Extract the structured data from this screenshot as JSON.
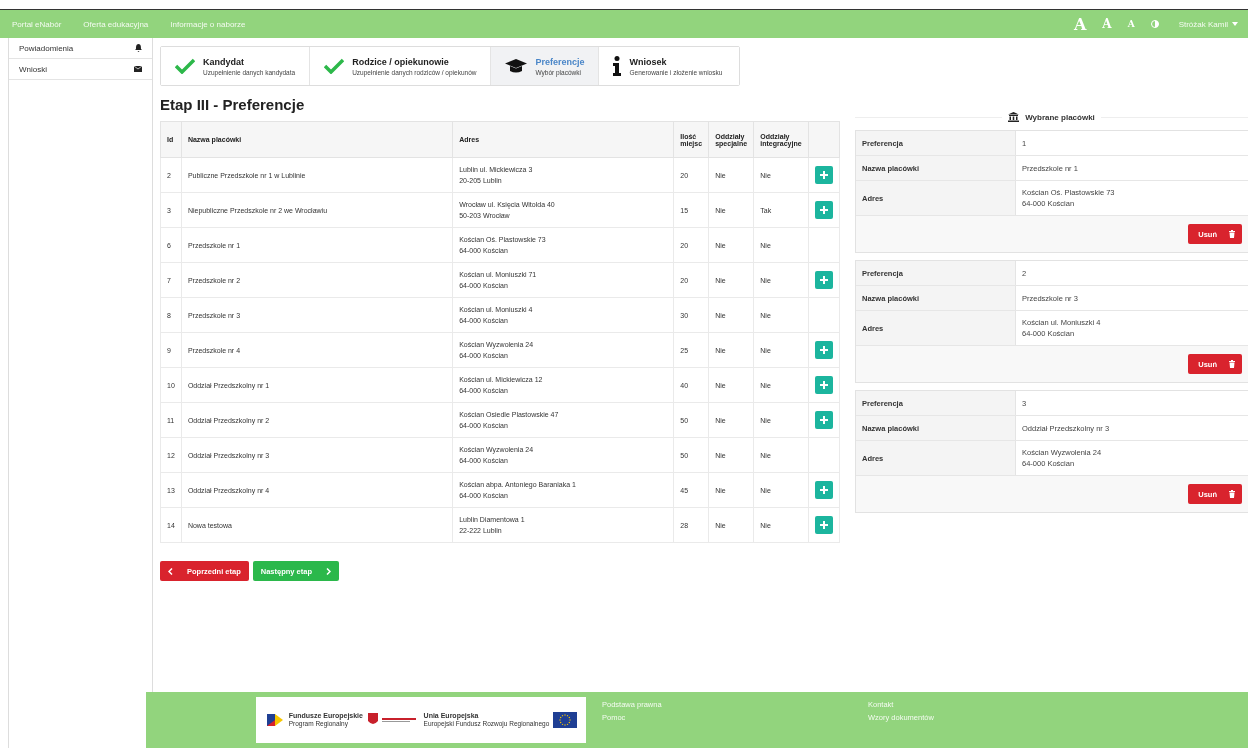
{
  "nav": {
    "links": [
      "Portal eNabór",
      "Oferta edukacyjna",
      "Informacje o naborze"
    ],
    "font_sizes": [
      "A",
      "A",
      "A"
    ],
    "user": "Stróżak Kamil"
  },
  "sidebar": {
    "items": [
      {
        "label": "Powiadomienia"
      },
      {
        "label": "Wnioski"
      }
    ]
  },
  "steps": [
    {
      "title": "Kandydat",
      "subtitle": "Uzupełnienie danych kandydata",
      "done": true,
      "selected": false
    },
    {
      "title": "Rodzice / opiekunowie",
      "subtitle": "Uzupełnienie danych rodziców / opiekunów",
      "done": true,
      "selected": false
    },
    {
      "title": "Preferencje",
      "subtitle": "Wybór placówki",
      "done": false,
      "selected": true
    },
    {
      "title": "Wniosek",
      "subtitle": "Generowanie i złożenie wniosku",
      "done": false,
      "selected": false
    }
  ],
  "heading": "Etap III - Preferencje",
  "table": {
    "columns": [
      "Id",
      "Nazwa placówki",
      "Adres",
      "Ilość miejsc",
      "Oddziały specjalne",
      "Oddziały integracyjne"
    ],
    "rows": [
      {
        "id": "2",
        "name": "Publiczne Przedszkole nr 1 w Lublinie",
        "address": [
          "Lublin ul. Mickiewicza 3",
          "20-205 Lublin"
        ],
        "places": "20",
        "special": "Nie",
        "integration": "Nie",
        "can_add": true
      },
      {
        "id": "3",
        "name": "Niepubliczne Przedszkole nr 2 we Wrocławiu",
        "address": [
          "Wrocław ul. Księcia Witolda 40",
          "50-203 Wrocław"
        ],
        "places": "15",
        "special": "Nie",
        "integration": "Tak",
        "can_add": true
      },
      {
        "id": "6",
        "name": "Przedszkole nr 1",
        "address": [
          "Kościan Oś. Plastowskie 73",
          "64-000 Kościan"
        ],
        "places": "20",
        "special": "Nie",
        "integration": "Nie",
        "can_add": false
      },
      {
        "id": "7",
        "name": "Przedszkole nr 2",
        "address": [
          "Kościan ul. Moniuszki 71",
          "64-000 Kościan"
        ],
        "places": "20",
        "special": "Nie",
        "integration": "Nie",
        "can_add": true
      },
      {
        "id": "8",
        "name": "Przedszkole nr 3",
        "address": [
          "Kościan ul. Moniuszki 4",
          "64-000 Kościan"
        ],
        "places": "30",
        "special": "Nie",
        "integration": "Nie",
        "can_add": false
      },
      {
        "id": "9",
        "name": "Przedszkole nr 4",
        "address": [
          "Kościan Wyzwolenia 24",
          "64-000 Kościan"
        ],
        "places": "25",
        "special": "Nie",
        "integration": "Nie",
        "can_add": true
      },
      {
        "id": "10",
        "name": "Oddział Przedszkolny nr 1",
        "address": [
          "Kościan ul. Mickiewicza 12",
          "64-000 Kościan"
        ],
        "places": "40",
        "special": "Nie",
        "integration": "Nie",
        "can_add": true
      },
      {
        "id": "11",
        "name": "Oddział Przedszkolny nr 2",
        "address": [
          "Kościan Osiedle Plastowskie 47",
          "64-000 Kościan"
        ],
        "places": "50",
        "special": "Nie",
        "integration": "Nie",
        "can_add": true
      },
      {
        "id": "12",
        "name": "Oddział Przedszkolny nr 3",
        "address": [
          "Kościan Wyzwolenia 24",
          "64-000 Kościan"
        ],
        "places": "50",
        "special": "Nie",
        "integration": "Nie",
        "can_add": false
      },
      {
        "id": "13",
        "name": "Oddział Przedszkolny nr 4",
        "address": [
          "Kościan abpa. Antoniego Baraniaka 1",
          "64-000 Kościan"
        ],
        "places": "45",
        "special": "Nie",
        "integration": "Nie",
        "can_add": true
      },
      {
        "id": "14",
        "name": "Nowa testowa",
        "address": [
          "Lublin Diamentowa 1",
          "22-222 Lublin"
        ],
        "places": "28",
        "special": "Nie",
        "integration": "Nie",
        "can_add": true
      }
    ]
  },
  "selected": {
    "title": "Wybrane placówki",
    "cards": [
      {
        "fields": [
          {
            "label": "Preferencja",
            "value": [
              "1"
            ]
          },
          {
            "label": "Nazwa placówki",
            "value": [
              "Przedszkole nr 1"
            ]
          },
          {
            "label": "Adres",
            "value": [
              "Kościan Oś. Plastowskie 73",
              "64-000 Kościan"
            ]
          }
        ],
        "delete_label": "Usuń"
      },
      {
        "fields": [
          {
            "label": "Preferencja",
            "value": [
              "2"
            ]
          },
          {
            "label": "Nazwa placówki",
            "value": [
              "Przedszkole nr 3"
            ]
          },
          {
            "label": "Adres",
            "value": [
              "Kościan ul. Moniuszki 4",
              "64-000 Kościan"
            ]
          }
        ],
        "delete_label": "Usuń"
      },
      {
        "fields": [
          {
            "label": "Preferencja",
            "value": [
              "3"
            ]
          },
          {
            "label": "Nazwa placówki",
            "value": [
              "Oddział Przedszkolny nr 3"
            ]
          },
          {
            "label": "Adres",
            "value": [
              "Kościan Wyzwolenia 24",
              "64-000 Kościan"
            ]
          }
        ],
        "delete_label": "Usuń"
      }
    ]
  },
  "prev_button": "Poprzedni etap",
  "next_button": "Następny etap",
  "footer": {
    "logos": [
      {
        "kind": "funds",
        "title": "Fundusze Europejskie",
        "subtitle": "Program Regionalny"
      },
      {
        "kind": "region"
      },
      {
        "kind": "union",
        "title": "Unia Europejska",
        "subtitle": "Europejski Fundusz Rozwoju Regionalnego"
      }
    ],
    "links_1": [
      "Podstawa prawna",
      "Pomoc"
    ],
    "links_2": [
      "Kontakt",
      "Wzory dokumentów"
    ]
  }
}
